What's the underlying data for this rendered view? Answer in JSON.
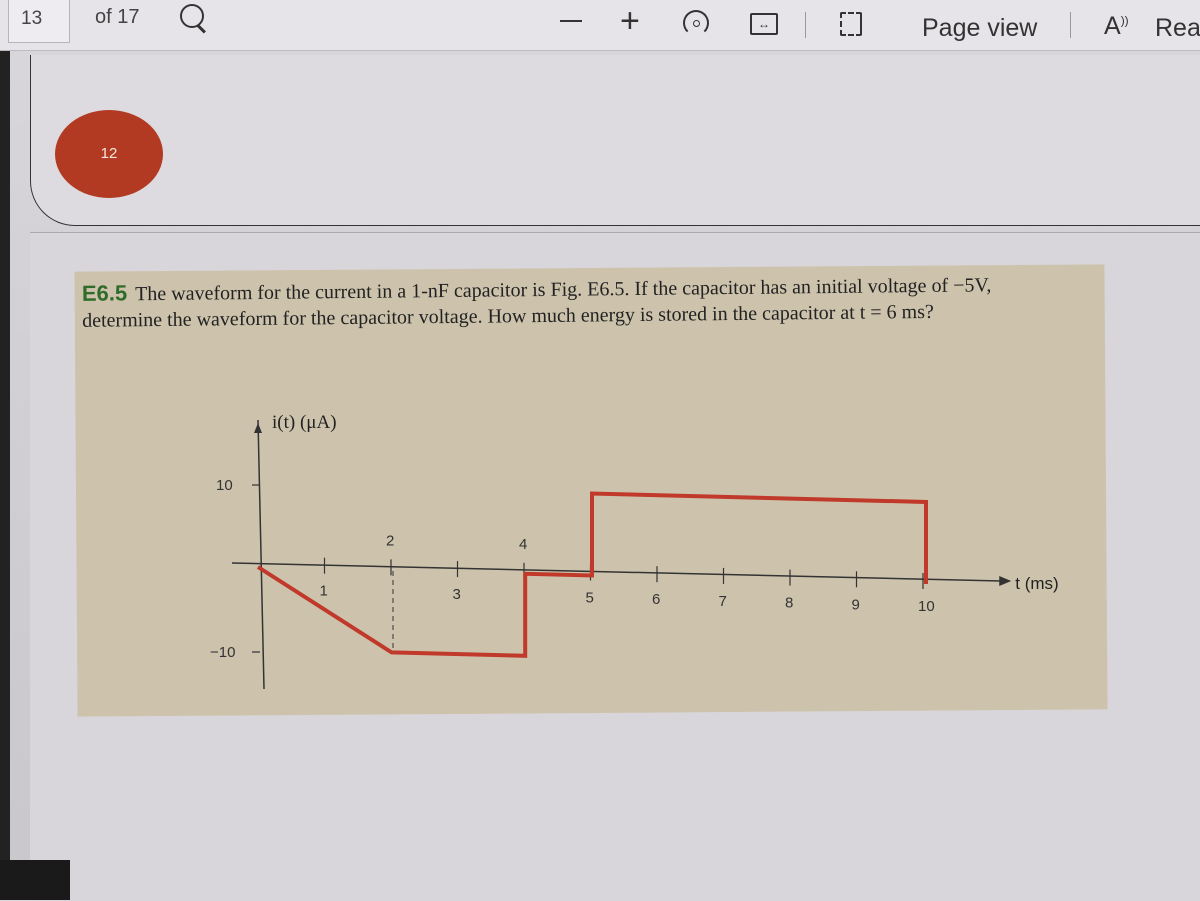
{
  "toolbar": {
    "current_page": "13",
    "page_of": "of 17",
    "page_view_label": "Page view",
    "read_label": "Read",
    "icons": [
      "search-icon",
      "zoom-out-icon",
      "zoom-in-icon",
      "rotate-icon",
      "fit-width-icon",
      "page-view-icon",
      "read-aloud-icon"
    ]
  },
  "thumbnail": {
    "badge": "12",
    "badge_color": "#b23a22"
  },
  "problem": {
    "number": "E6.5",
    "text": "The waveform for the current in a 1-nF capacitor is Fig. E6.5. If the capacitor has an initial voltage of −5V, determine the waveform for the capacitor voltage. How much energy is stored in the capacitor at t = 6 ms?"
  },
  "chart_data": {
    "type": "line",
    "title": "",
    "xlabel": "t (ms)",
    "ylabel": "i(t) (μA)",
    "xlim": [
      0,
      10.5
    ],
    "ylim": [
      -10,
      10
    ],
    "x_ticks": [
      1,
      2,
      3,
      4,
      5,
      6,
      7,
      8,
      9,
      10
    ],
    "y_ticks": [
      10,
      -10
    ],
    "grid": false,
    "line_color": "#c0392b",
    "series": [
      {
        "name": "i(t)",
        "x": [
          0,
          2,
          4,
          4,
          5,
          5,
          10,
          10
        ],
        "y": [
          0,
          -10,
          -10,
          0,
          0,
          10,
          10,
          0
        ]
      }
    ],
    "annotations": [
      {
        "type": "dashed-vertical",
        "x": 2,
        "from": 0,
        "to": -10
      }
    ]
  }
}
